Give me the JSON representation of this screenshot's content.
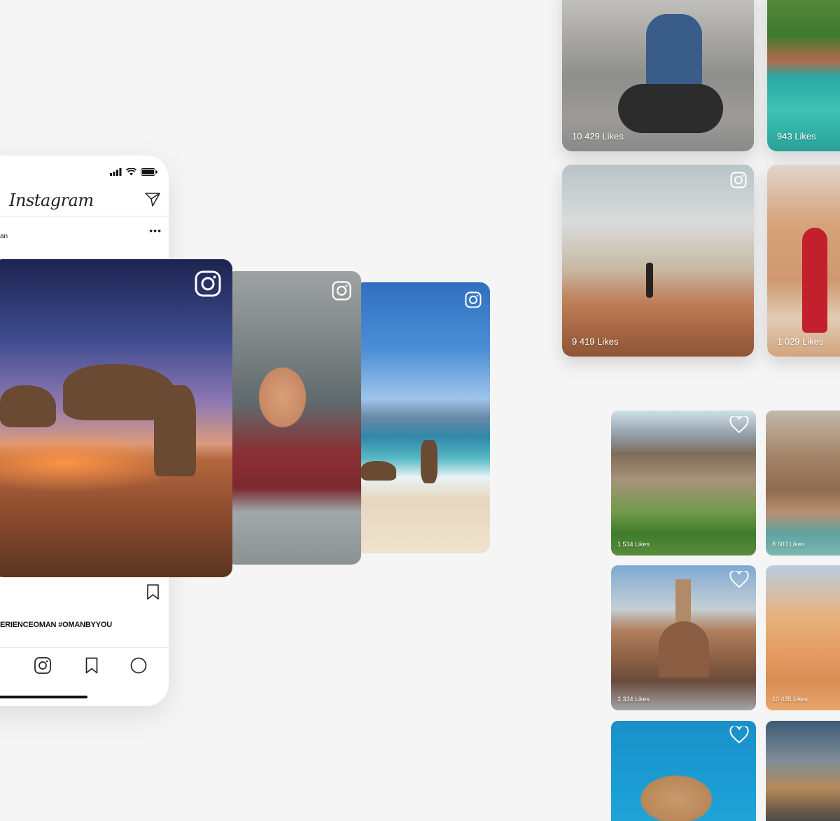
{
  "phone": {
    "app_title": "Instagram",
    "post_username_fragment": "an",
    "more_glyph": "•••",
    "caption": "ERIENCEOMAN #OMANBYYOU"
  },
  "feed_cards": [
    {
      "name": "camels-desert-night"
    },
    {
      "name": "girl-in-vehicle"
    },
    {
      "name": "camels-on-beach"
    }
  ],
  "top_grid": [
    {
      "likes": "10 429 Likes"
    },
    {
      "likes": "943 Likes"
    },
    {
      "likes": "9 419 Likes"
    },
    {
      "likes": "1 029 Likes"
    }
  ],
  "bottom_grid": [
    {
      "likes": "1 534 Likes"
    },
    {
      "likes": "8 603 Likes"
    },
    {
      "likes": "2 334 Likes"
    },
    {
      "likes": "10 435 Likes"
    },
    {
      "likes": ""
    },
    {
      "likes": ""
    }
  ],
  "icons": {
    "status": [
      "signal-icon",
      "wifi-icon",
      "battery-icon"
    ],
    "header": [
      "send-icon"
    ],
    "nav": [
      "home-icon",
      "instagram-icon",
      "bookmark-icon",
      "profile-icon"
    ],
    "card": "instagram-badge-icon",
    "tile": "heart-icon"
  },
  "colors": {
    "background": "#f5f5f5",
    "phone": "#ffffff",
    "text": "#111111"
  }
}
